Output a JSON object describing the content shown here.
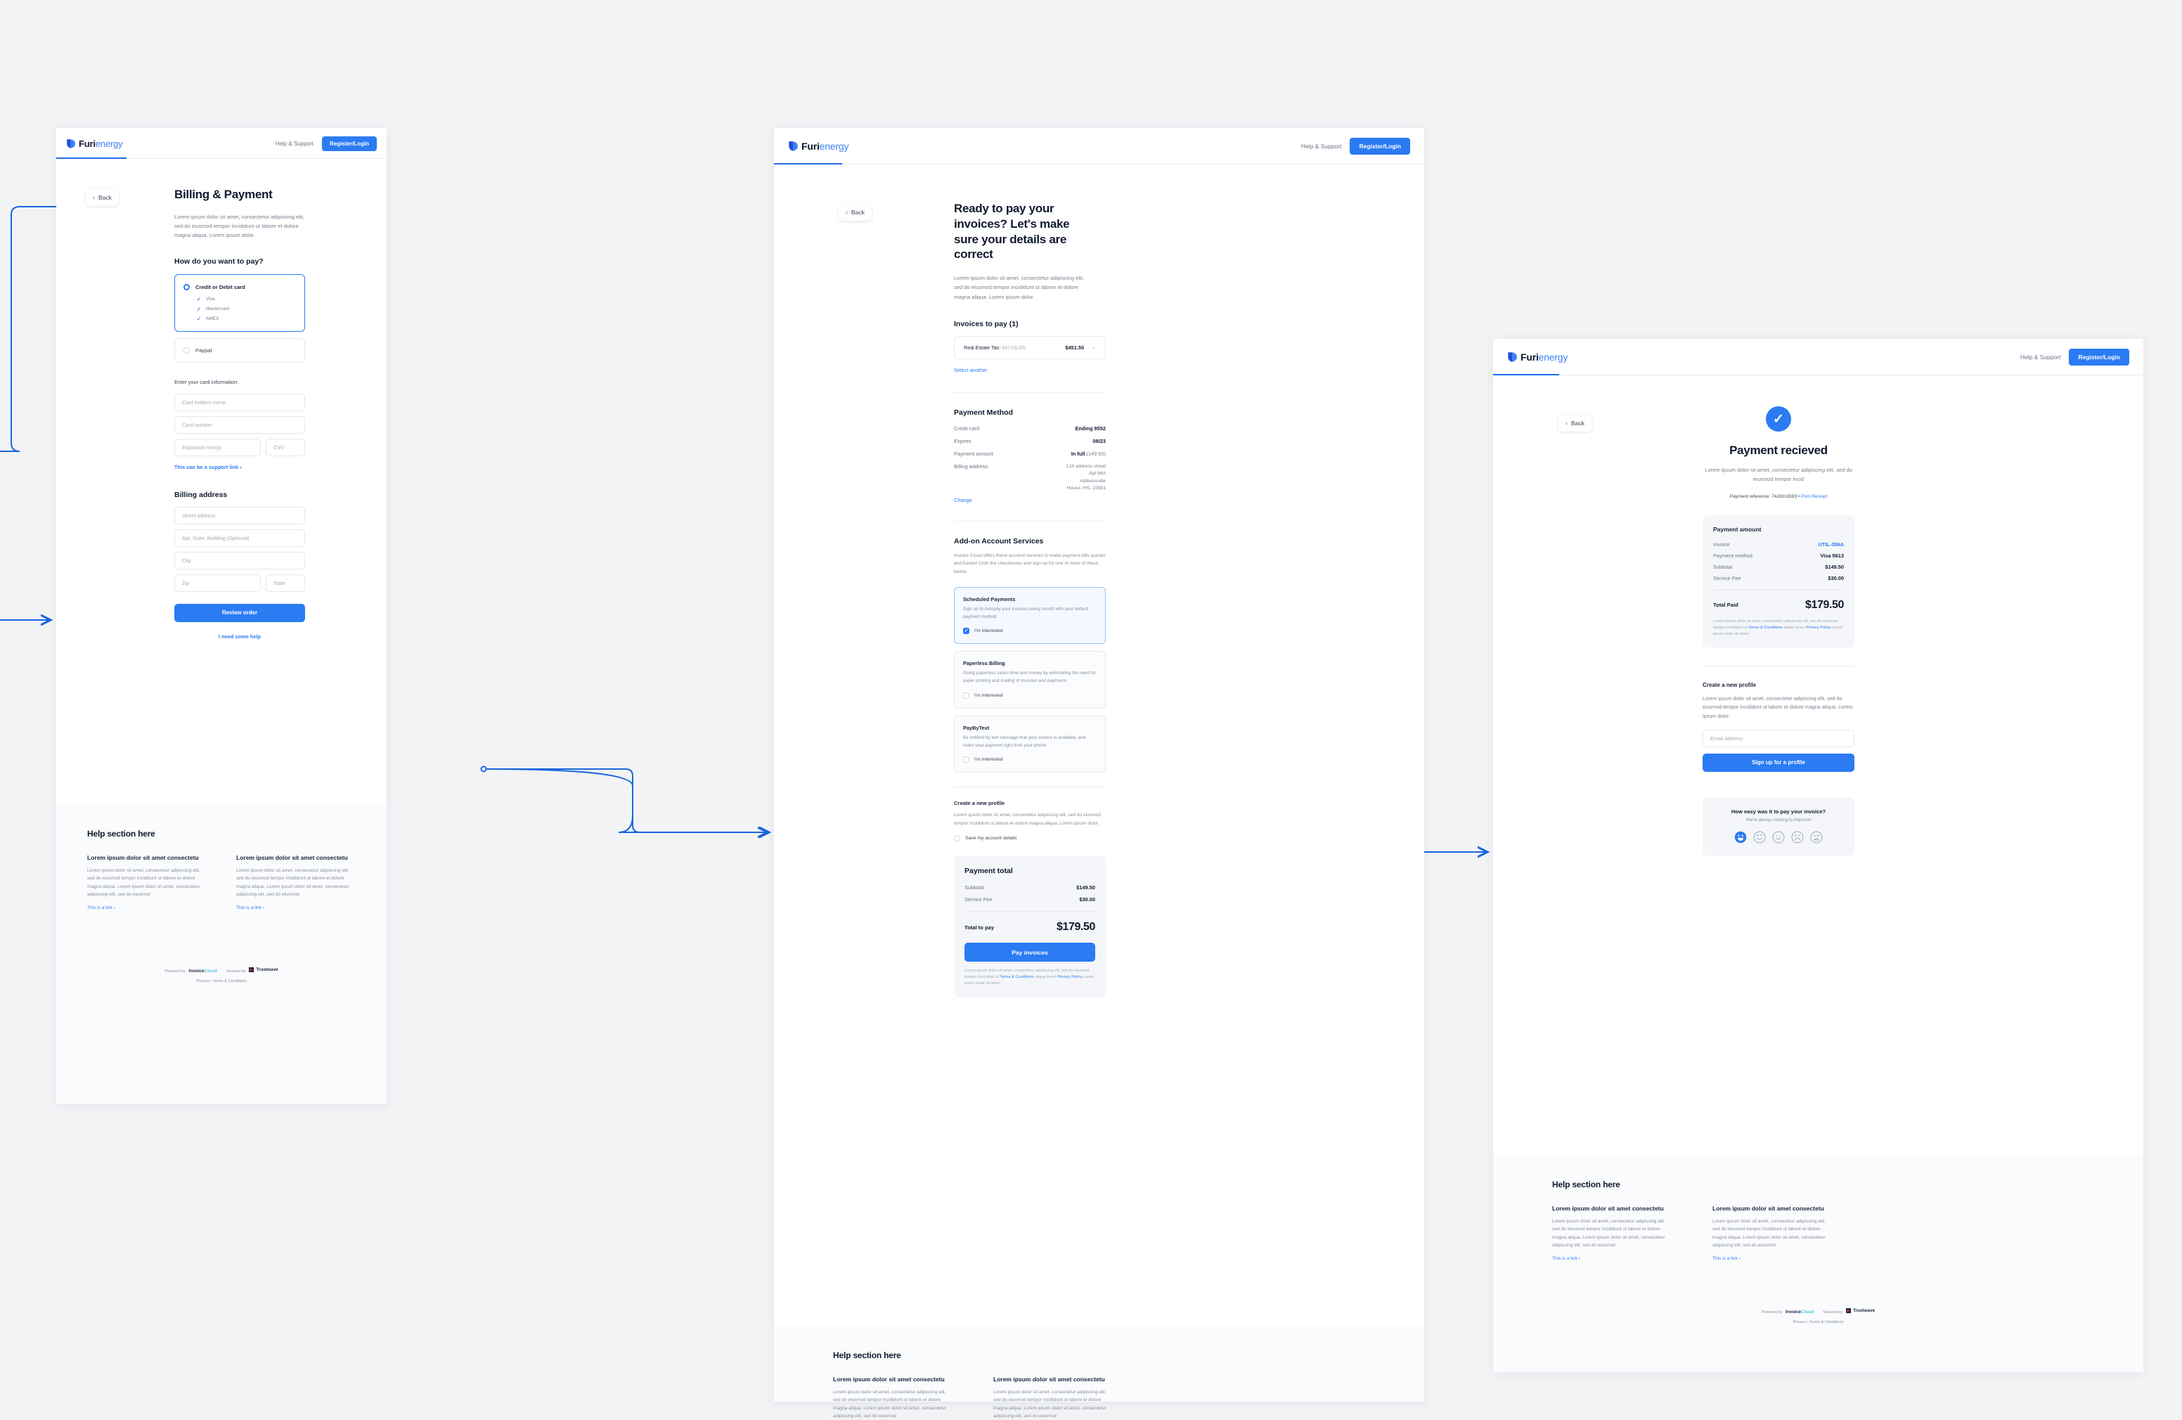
{
  "brand": {
    "name_a": "Furi",
    "name_b": "energy"
  },
  "nav": {
    "help": "Help & Support",
    "login": "Register/Login"
  },
  "common": {
    "back": "Back",
    "chevron_left": "‹",
    "chevron_right": "›",
    "chevron_down": "⌄",
    "interested": "I'm interested",
    "terms": "Terms & Conditions",
    "privacy": "Privacy Policy",
    "legal_pre": "Lorem ipsum dolor sit amet, consectetur adipiscing elit, sed do eiusmod tempor incididunt ut ",
    "legal_mid": " aliqua lorem ",
    "legal_post": ".Lorem ipsum dolor sit amet."
  },
  "help": {
    "title": "Help section here",
    "columns": [
      {
        "heading": "Lorem ipsum dolor sit amet consectetu",
        "body": "Lorem ipsum dolor sit amet, consectetur adipiscing elit, sed do eiusmod tempor incididunt ut labore et dolore magna aliqua. Lorem ipsum dolor sit amet, consectetur adipiscing elit, sed do eiusmod",
        "link": "This is a link"
      },
      {
        "heading": "Lorem ipsum dolor sit amet consectetu",
        "body": "Lorem ipsum dolor sit amet, consectetur adipiscing elit, sed do eiusmod tempor incididunt ut labore et dolore magna aliqua. Lorem ipsum dolor sit amet, consectetur adipiscing elit, sed do eiusmod",
        "link": "This is a link"
      }
    ]
  },
  "footer": {
    "powered_by": "Powered by",
    "invoicecloud": {
      "part1": "Invoice",
      "part2": "Cloud",
      "part3": "®"
    },
    "secured_by": "Secured by",
    "trustwave": "Trustwave",
    "privacy": "Privacy",
    "separator": "•",
    "terms": "Terms & Conditions"
  },
  "screen1": {
    "title": "Billing & Payment",
    "lede": "Lorem ipsum dolor sit amet, consectetur adipiscing elit, sed do eiusmod tempor incididunt ut labore et dolore magna aliqua. Lorem ipsum dolor.",
    "pay_question": "How do you want to pay?",
    "methods": [
      {
        "label": "Credit or Debit card",
        "selected": true,
        "brands": [
          "Visa",
          "Mastercard",
          "AMEX"
        ]
      },
      {
        "label": "Paypal",
        "selected": false,
        "brands": []
      }
    ],
    "card_info_label": "Enter your card information:",
    "card_fields": {
      "holder": "Card holders name",
      "number": "Card number",
      "expiration": "Expiration mm/yy",
      "cvv": "CVV"
    },
    "support_link": "This can be a support link",
    "billing_heading": "Billing address",
    "address_fields": {
      "street": "Street address",
      "apt": "Apt, Suite, Building (Optional)",
      "city": "City",
      "zip": "Zip",
      "state": "State"
    },
    "review_button": "Review order",
    "help_link": "I need some help"
  },
  "screen2": {
    "title": "Ready to pay your invoices? Let's make sure your details are correct",
    "lede": "Lorem ipsum dolor sit amet, consectetur adipiscing elit, sed do eiusmod tempor incididunt ut labore et dolore magna aliqua. Lorem ipsum dolor.",
    "invoices_heading": "Invoices to pay (1)",
    "invoice": {
      "name": "Real Estate Tax:",
      "number": "45713LG5",
      "amount": "$451.50"
    },
    "select_another": "Select another",
    "payment_method": {
      "heading": "Payment Method",
      "rows": [
        {
          "key": "Credit card",
          "value": "Ending 9552"
        },
        {
          "key": "Expires",
          "value": "08/23"
        },
        {
          "key": "Payment amount",
          "value": "In full",
          "value_muted": "(149.50)"
        }
      ],
      "address_key": "Billing address",
      "address_lines": [
        "124 address street",
        "Apt 56A",
        "Addressville",
        "House, HS, 15581"
      ],
      "change": "Change"
    },
    "addons": {
      "heading": "Add-on Account Services",
      "lede": "Invoice Cloud offers these account services to make payment bills quicker and Easier! Click the checkboxes and sign up for one or more of these below.",
      "services": [
        {
          "title": "Scheduled Payments",
          "desc": "Sign up to Autopay your invoices every month with your default payment method",
          "checked": true
        },
        {
          "title": "Paperless Billing",
          "desc": "Going paperless saves time and money by eliminating the need for paper printing and mailing of invoices and payments",
          "checked": false
        },
        {
          "title": "PayByText",
          "desc": "Be notified by text message that your invoice is available, and make your payment right from your phone",
          "checked": false
        }
      ]
    },
    "profile": {
      "heading": "Create a new profile",
      "desc": "Lorem ipsum dolor sit amet, consectetur adipiscing elit, sed do eiusmod tempor incididunt ut labore et dolore magna aliqua. Lorem ipsum dolor.",
      "save_label": "Save my account details",
      "checked": false
    },
    "total": {
      "heading": "Payment total",
      "rows": [
        {
          "key": "Subtotal",
          "value": "$149.50"
        },
        {
          "key": "Service Fee",
          "value": "$30.00"
        }
      ],
      "total_label": "Total to pay",
      "total_value": "$179.50",
      "button": "Pay invoices"
    }
  },
  "screen3": {
    "status_title": "Payment recieved",
    "status_desc": "Lorem ipsum dolor sit amet, consectetur adipiscing elit, sed do eiusmod tempor incid",
    "reference_label": "Payment reference:",
    "reference": "74JGHJD83",
    "print_receipt": "Print Receipt",
    "receipt": {
      "heading": "Payment amount",
      "rows": [
        {
          "key": "Invoice",
          "value": "UTIL-356A",
          "blue": true
        },
        {
          "key": "Payment method",
          "value": "Visa 5613",
          "blue": false
        },
        {
          "key": "Subtotal",
          "value": "$149.50",
          "blue": false
        },
        {
          "key": "Service Fee",
          "value": "$30.00",
          "blue": false
        }
      ],
      "total_label": "Total Paid",
      "total_value": "$179.50"
    },
    "profile": {
      "heading": "Create a new profile",
      "desc": "Lorem ipsum dolor sit amet, consectetur adipiscing elit, sed do eiusmod tempor incididunt ut labore et dolore magna aliqua. Lorem ipsum dolor.",
      "email_placeholder": "Email address",
      "button": "Sign up for a profile"
    },
    "feedback": {
      "question": "How easy was it to pay your invoice?",
      "subtitle": "We're always looking to improve!",
      "faces": [
        {
          "name": "face-grin",
          "selected": true
        },
        {
          "name": "face-smile",
          "selected": false
        },
        {
          "name": "face-neutral",
          "selected": false
        },
        {
          "name": "face-frown",
          "selected": false
        },
        {
          "name": "face-distress",
          "selected": false
        }
      ]
    }
  },
  "colors": {
    "accent": "#2b7bf3",
    "connector": "#1767dd",
    "ink": "#101a2e",
    "muted": "#77808f",
    "panel": "#f4f6f9"
  }
}
